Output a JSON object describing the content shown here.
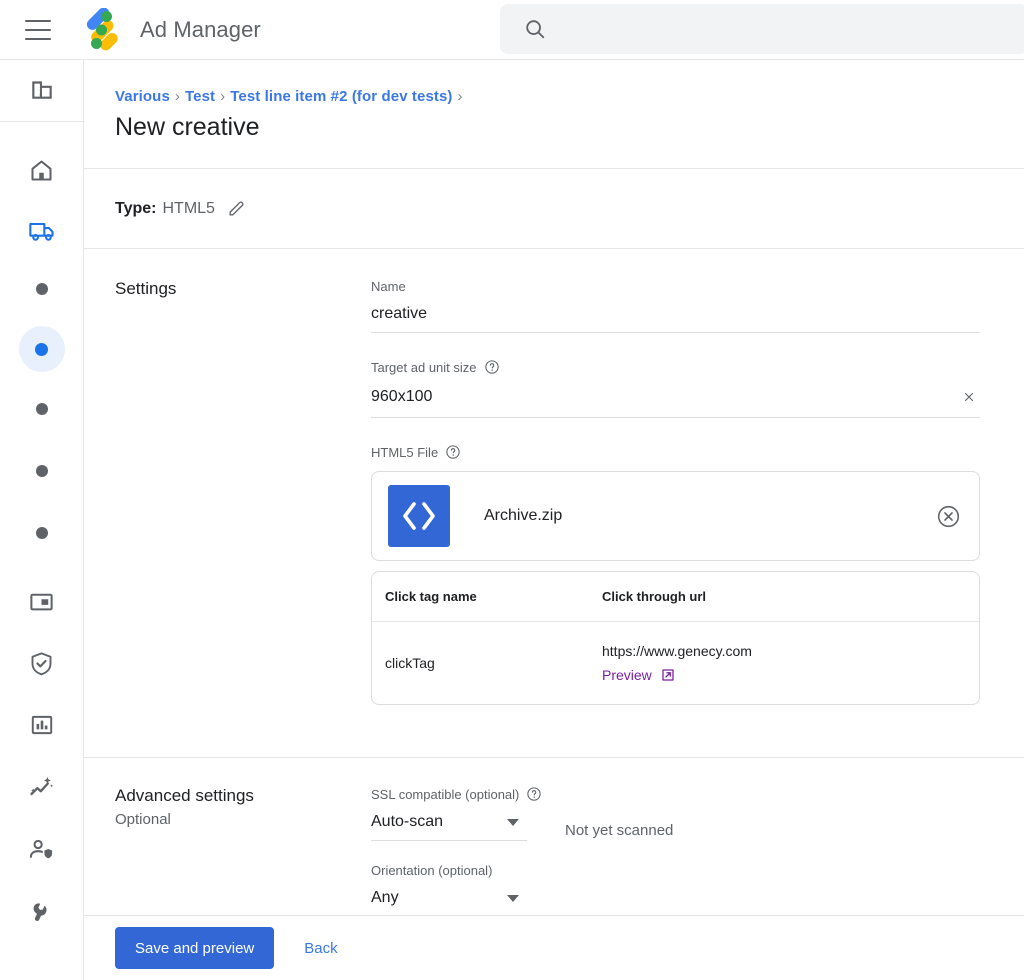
{
  "header": {
    "menu_icon": "hamburger-icon",
    "logo_icon": "ad-manager-logo",
    "brand": "Ad Manager",
    "search": {
      "value": "",
      "placeholder": "",
      "icon": "search-icon"
    }
  },
  "rail": {
    "items": [
      {
        "icon": "building-icon",
        "type": "icon"
      },
      {
        "icon": "home-icon",
        "type": "icon"
      },
      {
        "icon": "delivery-truck-icon",
        "type": "icon",
        "active": true
      },
      {
        "icon": "dot-icon",
        "type": "dot"
      },
      {
        "icon": "dot-icon",
        "type": "dot",
        "active": true
      },
      {
        "icon": "dot-icon",
        "type": "dot"
      },
      {
        "icon": "dot-icon",
        "type": "dot"
      },
      {
        "icon": "dot-icon",
        "type": "dot"
      },
      {
        "icon": "inventory-icon",
        "type": "icon"
      },
      {
        "icon": "shield-check-icon",
        "type": "icon"
      },
      {
        "icon": "bar-chart-icon",
        "type": "icon"
      },
      {
        "icon": "trending-up-icon",
        "type": "icon"
      },
      {
        "icon": "person-shield-icon",
        "type": "icon"
      },
      {
        "icon": "wrench-icon",
        "type": "icon"
      }
    ]
  },
  "breadcrumb": {
    "items": [
      "Various",
      "Test",
      "Test line item #2 (for dev tests)"
    ],
    "separator": "›"
  },
  "page": {
    "title": "New creative"
  },
  "type_row": {
    "label": "Type:",
    "value": "HTML5",
    "edit_icon": "pencil-icon"
  },
  "settings": {
    "heading": "Settings",
    "name": {
      "label": "Name",
      "value": "creative"
    },
    "ad_unit_size": {
      "label": "Target ad unit size",
      "help_icon": "help-circle-icon",
      "value": "960x100",
      "clear_icon": "close-icon"
    },
    "html5_file": {
      "label": "HTML5 File",
      "help_icon": "help-circle-icon",
      "file_icon": "code-brackets-icon",
      "file_name": "Archive.zip",
      "remove_icon": "remove-circle-icon"
    },
    "click_tags": {
      "columns": [
        "Click tag name",
        "Click through url"
      ],
      "rows": [
        {
          "name": "clickTag",
          "url": "https://www.genecy.com",
          "preview_label": "Preview",
          "preview_icon": "external-link-icon"
        }
      ]
    }
  },
  "advanced": {
    "heading": "Advanced settings",
    "subheading": "Optional",
    "ssl": {
      "label": "SSL compatible (optional)",
      "help_icon": "help-circle-icon",
      "value": "Auto-scan",
      "caret_icon": "chevron-down-icon",
      "status": "Not yet scanned"
    },
    "orientation": {
      "label": "Orientation (optional)",
      "value": "Any",
      "caret_icon": "chevron-down-icon"
    }
  },
  "footer": {
    "save_label": "Save and preview",
    "back_label": "Back"
  },
  "colors": {
    "accent_blue": "#1a73e8",
    "button_blue": "#3367d6",
    "link_purple": "#7b1fa2",
    "text_grey": "#5f6368"
  }
}
